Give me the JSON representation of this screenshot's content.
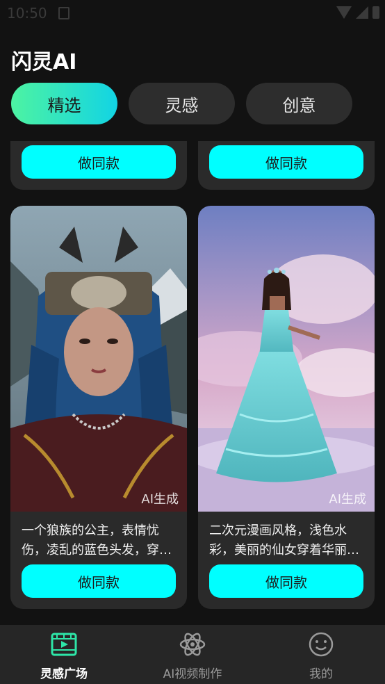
{
  "status": {
    "time": "10:50"
  },
  "app": {
    "title": "闪灵AI"
  },
  "tabs": [
    {
      "label": "精选",
      "active": true
    },
    {
      "label": "灵感"
    },
    {
      "label": "创意"
    }
  ],
  "cards": [
    {
      "button": "做同款"
    },
    {
      "button": "做同款"
    },
    {
      "tag": "AI生成",
      "desc": "一个狼族的公主，表情忧伤，凌乱的蓝色头发，穿…",
      "button": "做同款"
    },
    {
      "tag": "AI生成",
      "desc": "二次元漫画风格，浅色水彩，美丽的仙女穿着华丽…",
      "button": "做同款"
    }
  ],
  "nav": [
    {
      "label": "灵感广场",
      "icon": "film-play-icon",
      "active": true
    },
    {
      "label": "AI视频制作",
      "icon": "atom-icon"
    },
    {
      "label": "我的",
      "icon": "smiley-icon"
    }
  ],
  "colors": {
    "accent": "#00ffff",
    "tab_gradient_start": "#4df3a2",
    "tab_gradient_end": "#12d4e4",
    "nav_active": "#2ee6a8"
  }
}
